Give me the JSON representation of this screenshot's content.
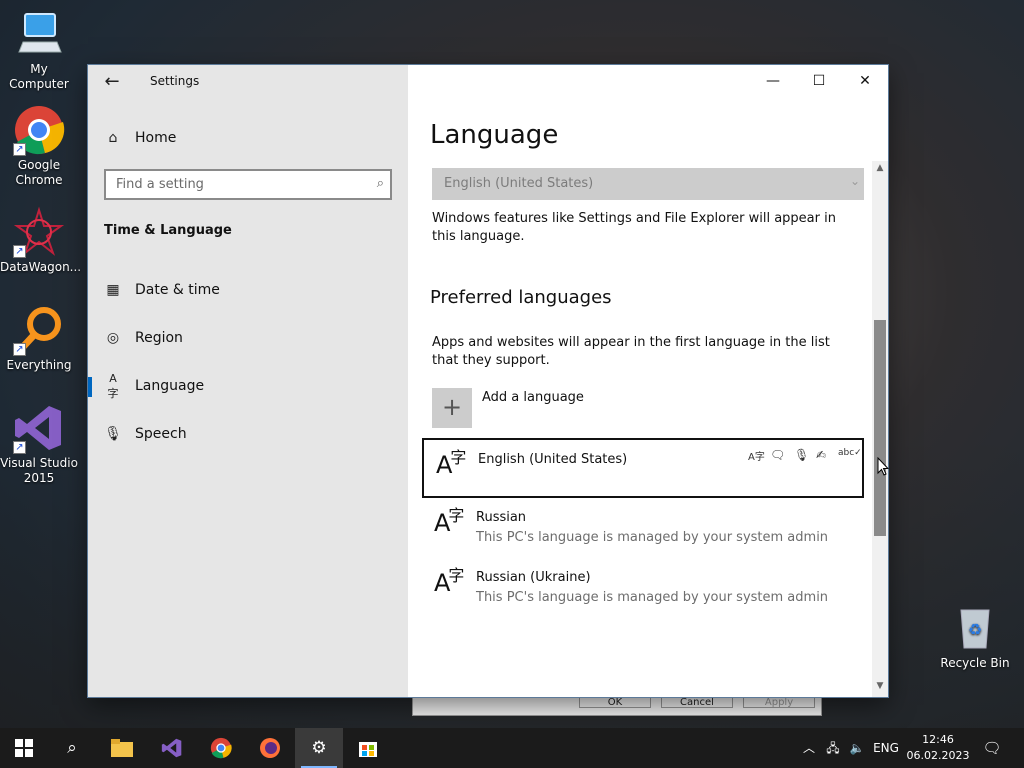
{
  "desktop": {
    "icons": [
      {
        "label": "My Computer"
      },
      {
        "label": "Google Chrome"
      },
      {
        "label": "DataWagon..."
      },
      {
        "label": "Everything"
      },
      {
        "label": "Visual Studio 2015"
      },
      {
        "label": "Recycle Bin"
      }
    ]
  },
  "window": {
    "app_title": "Settings",
    "caption": {
      "minimize": "—",
      "maximize": "☐",
      "close": "✕"
    }
  },
  "sidebar": {
    "home_label": "Home",
    "search_placeholder": "Find a setting",
    "section_title": "Time & Language",
    "items": [
      {
        "label": "Date & time",
        "icon": "calendar-clock-icon"
      },
      {
        "label": "Region",
        "icon": "globe-icon"
      },
      {
        "label": "Language",
        "icon": "language-icon",
        "active": true
      },
      {
        "label": "Speech",
        "icon": "microphone-icon"
      }
    ]
  },
  "main": {
    "title": "Language",
    "display_language": "English (United States)",
    "display_note": "Windows features like Settings and File Explorer will appear in this language.",
    "preferred_heading": "Preferred languages",
    "preferred_note": "Apps and websites will appear in the first language in the list that they support.",
    "add_language": "Add a language",
    "languages": [
      {
        "name": "English (United States)",
        "sub": ""
      },
      {
        "name": "Russian",
        "sub": "This PC's language is managed by your system admin"
      },
      {
        "name": "Russian (Ukraine)",
        "sub": "This PC's language is managed by your system admin"
      }
    ],
    "feature_icons": {
      "display": "A字",
      "speech_rec": "🗨",
      "mic": "🎙",
      "handwriting": "✍",
      "spell": "abc✓"
    }
  },
  "behind_dialog": {
    "ok": "OK",
    "cancel": "Cancel",
    "apply": "Apply"
  },
  "taskbar": {
    "tray_lang": "ENG",
    "time": "12:46",
    "date": "06.02.2023"
  }
}
